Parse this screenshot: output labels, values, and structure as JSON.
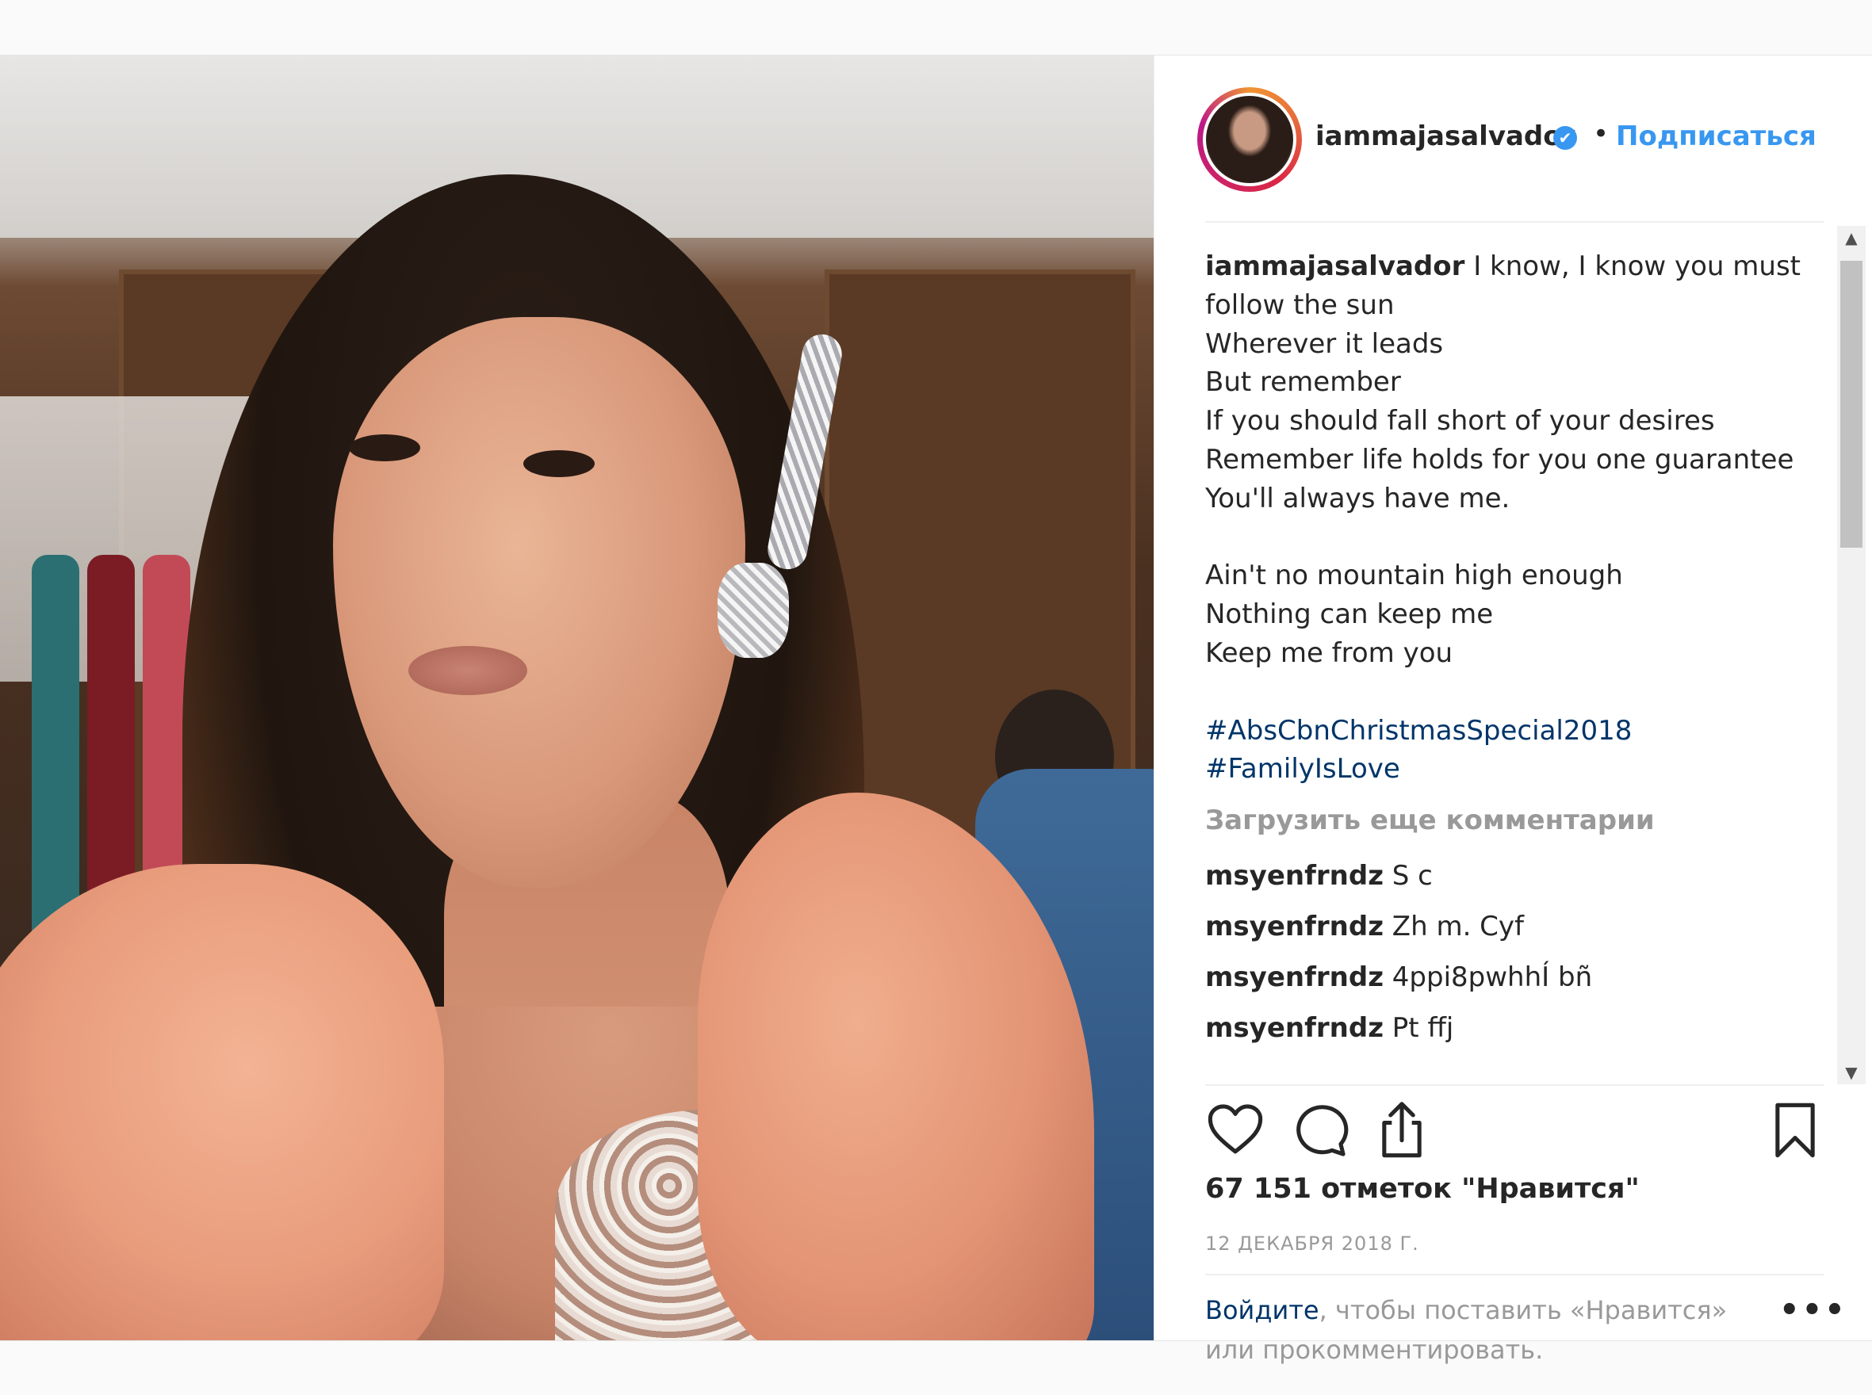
{
  "post": {
    "username": "iammajasalvador",
    "verified_glyph": "✔",
    "separator": "•",
    "follow_label": "Подписаться",
    "caption_username": "iammajasalvador",
    "caption_lines": [
      " I know, I know you must",
      "follow the sun",
      "Wherever it leads",
      "But remember",
      "If you should fall short of your desires",
      "Remember life holds for you one guarantee",
      "You'll always have me.",
      "",
      "Ain't no mountain high enough",
      "Nothing can keep me",
      "Keep me from you",
      ""
    ],
    "hashtags": [
      "#AbsCbnChristmasSpecial2018",
      "#FamilyIsLove"
    ],
    "load_more": "Загрузить еще комментарии",
    "comments": [
      {
        "user": "msyenfrndz",
        "text": "S c"
      },
      {
        "user": "msyenfrndz",
        "text": "Zh m. Cyf"
      },
      {
        "user": "msyenfrndz",
        "text": "4ppi8pwhhÍ bñ"
      },
      {
        "user": "msyenfrndz",
        "text": "Pt ffj"
      }
    ],
    "likes": "67 151 отметок \"Нравится\"",
    "date": "12 ДЕКАБРЯ 2018 Г.",
    "login_link": "Войдите",
    "login_rest": ", чтобы поставить «Нравится» или прокомментировать.",
    "more_label": "•••"
  },
  "icons": {
    "like": "heart-icon",
    "comment": "comment-icon",
    "share": "share-icon",
    "save": "bookmark-icon",
    "verified": "verified-badge-icon"
  },
  "colors": {
    "link": "#3897f0",
    "hashtag": "#003569",
    "muted": "#999999",
    "text": "#262626"
  }
}
